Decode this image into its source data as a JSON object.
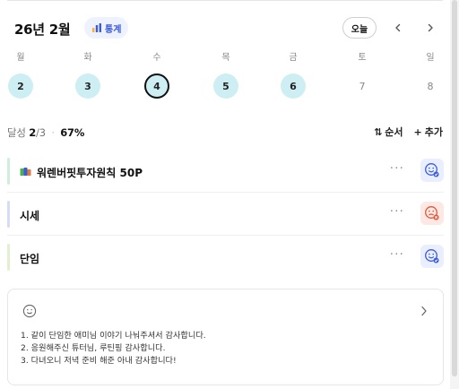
{
  "header": {
    "month_title": "26년 2월",
    "stats_label": "통계",
    "today_label": "오늘",
    "prev_icon": "chevron-left-icon",
    "next_icon": "chevron-right-icon"
  },
  "week": {
    "days": [
      {
        "dow": "월",
        "date": "2",
        "state": "done"
      },
      {
        "dow": "화",
        "date": "3",
        "state": "done"
      },
      {
        "dow": "수",
        "date": "4",
        "state": "today"
      },
      {
        "dow": "목",
        "date": "5",
        "state": "done"
      },
      {
        "dow": "금",
        "date": "6",
        "state": "done"
      },
      {
        "dow": "토",
        "date": "7",
        "state": "future"
      },
      {
        "dow": "일",
        "date": "8",
        "state": "future"
      }
    ]
  },
  "progress": {
    "label": "달성",
    "done": "2",
    "total": "/3",
    "separator": "·",
    "percent": "67%"
  },
  "actions": {
    "sort_label": "순서",
    "add_label": "추가"
  },
  "tasks": [
    {
      "title": "워렌버핏투자원칙 50P",
      "icon": "books-icon",
      "bar_color": "#cfeede",
      "status": "good"
    },
    {
      "title": "시세",
      "icon": "",
      "bar_color": "#d6dcf7",
      "status": "bad"
    },
    {
      "title": "단임",
      "icon": "",
      "bar_color": "#e3f0cf",
      "status": "good"
    }
  ],
  "gratitude": {
    "icon": "smile-icon",
    "items": [
      "1. 같이 단임한 애미님 이야기 나눠주셔서 감사합니다.",
      "2. 응원해주신 튜터님, 루틴핑 감사합니다.",
      "3. 다녀오니 저녁 준비 해준 아내 감사합니다!"
    ]
  },
  "colors": {
    "accent": "#3b5bdb",
    "done_day": "#cdeef2",
    "status_good_bg": "#e9efff",
    "status_bad_bg": "#fde8e3"
  }
}
